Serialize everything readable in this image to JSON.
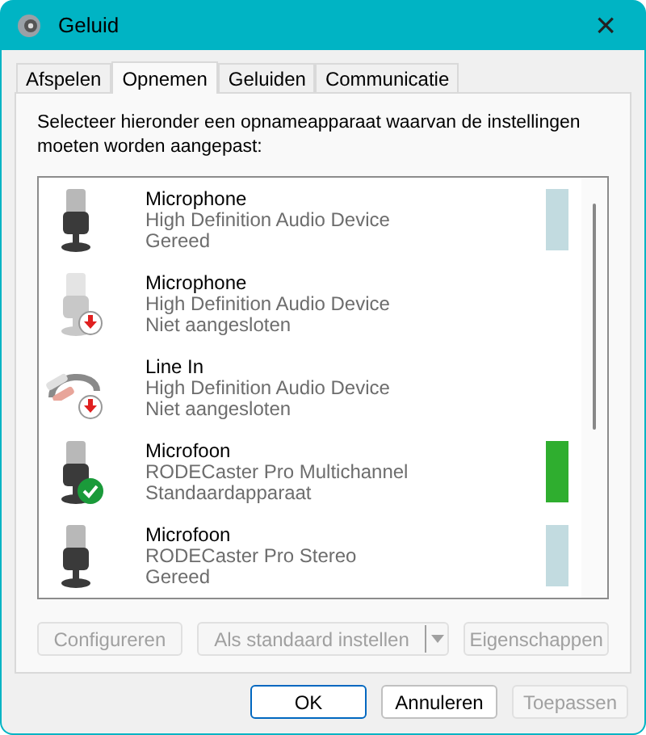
{
  "window": {
    "title": "Geluid",
    "close": "×"
  },
  "tabs": [
    {
      "label": "Afspelen",
      "selected": false
    },
    {
      "label": "Opnemen",
      "selected": true
    },
    {
      "label": "Geluiden",
      "selected": false
    },
    {
      "label": "Communicatie",
      "selected": false
    }
  ],
  "instruction": "Selecteer hieronder een opnameapparaat waarvan de instellingen moeten worden aangepast:",
  "devices": [
    {
      "kind": "mic",
      "name": "Microphone",
      "device": "High Definition Audio Device",
      "status": "Gereed",
      "unplugged": false,
      "default": false,
      "level": 0
    },
    {
      "kind": "mic",
      "name": "Microphone",
      "device": "High Definition Audio Device",
      "status": "Niet aangesloten",
      "unplugged": true,
      "default": false
    },
    {
      "kind": "line",
      "name": "Line In",
      "device": "High Definition Audio Device",
      "status": "Niet aangesloten",
      "unplugged": true,
      "default": false
    },
    {
      "kind": "mic",
      "name": "Microfoon",
      "device": "RODECaster Pro Multichannel",
      "status": "Standaardapparaat",
      "unplugged": false,
      "default": true,
      "level": 1
    },
    {
      "kind": "mic",
      "name": "Microfoon",
      "device": "RODECaster Pro Stereo",
      "status": "Gereed",
      "unplugged": false,
      "default": false,
      "level": 0
    }
  ],
  "actions": [
    {
      "label": "Configureren",
      "disabled": true,
      "kind": "button"
    },
    {
      "label": "Als standaard instellen",
      "disabled": true,
      "kind": "split"
    },
    {
      "label": "Eigenschappen",
      "disabled": true,
      "kind": "button"
    }
  ],
  "dialog_buttons": [
    {
      "label": "OK",
      "disabled": false,
      "default": true
    },
    {
      "label": "Annuleren",
      "disabled": false,
      "default": false
    },
    {
      "label": "Toepassen",
      "disabled": true,
      "default": false
    }
  ]
}
